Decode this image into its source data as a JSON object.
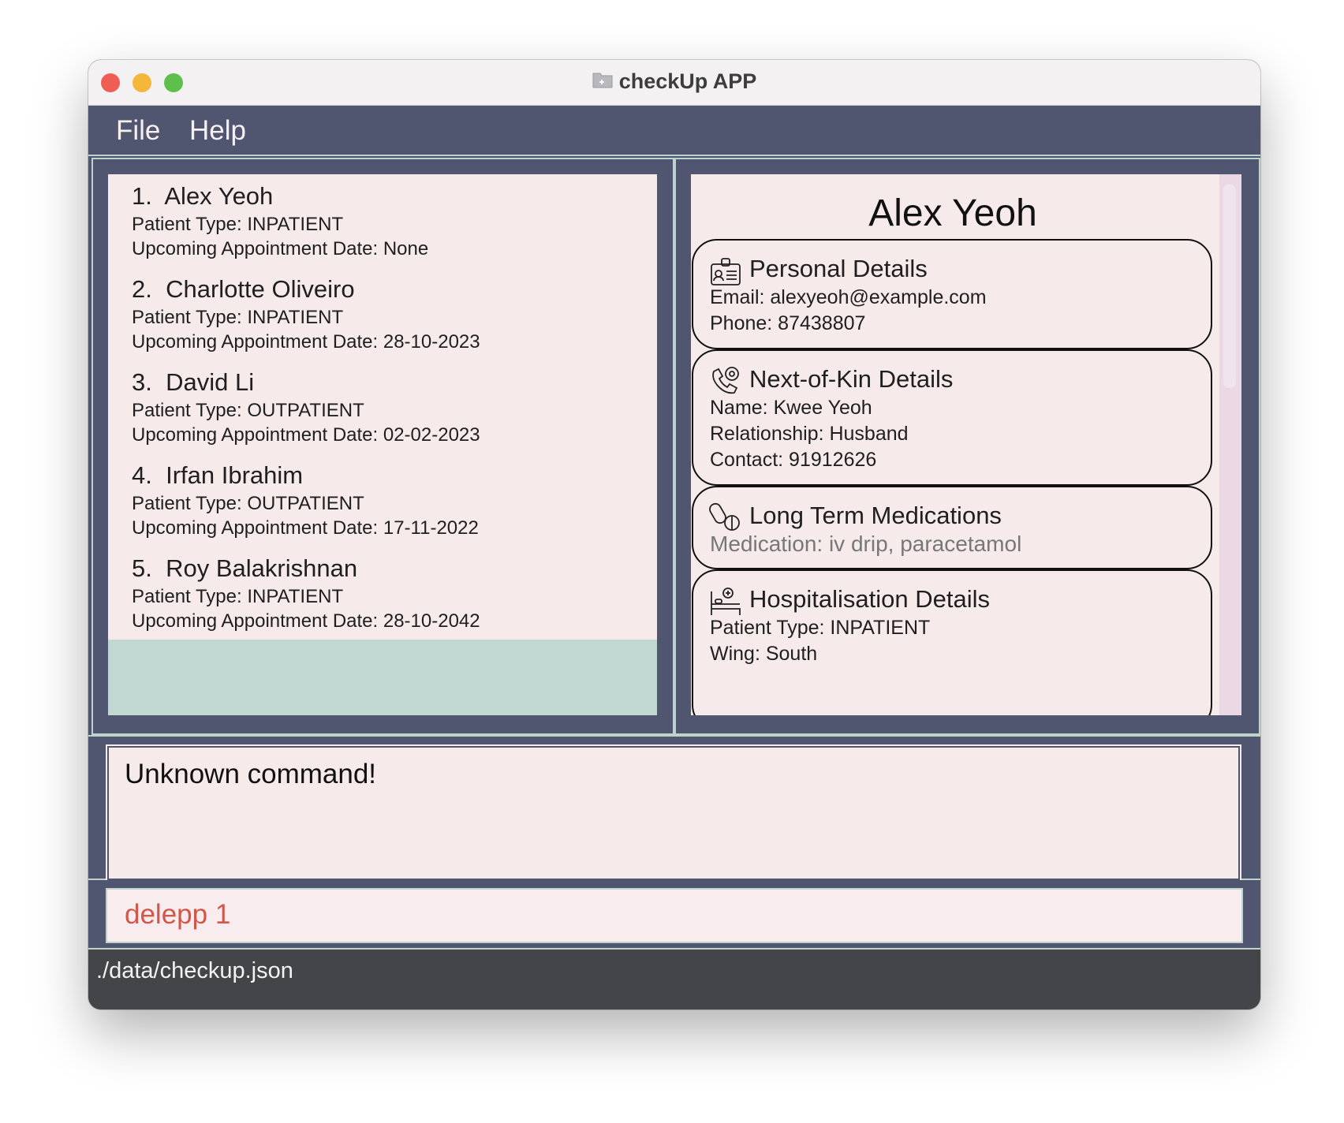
{
  "window": {
    "title": "checkUp APP",
    "title_icon": "folder-icon"
  },
  "menu": {
    "file": "File",
    "help": "Help"
  },
  "patients": [
    {
      "index": "1.",
      "name": "Alex Yeoh",
      "type": "Patient Type: INPATIENT",
      "appointment": "Upcoming Appointment Date: None"
    },
    {
      "index": "2.",
      "name": "Charlotte Oliveiro",
      "type": "Patient Type: INPATIENT",
      "appointment": "Upcoming Appointment Date: 28-10-2023"
    },
    {
      "index": "3.",
      "name": "David Li",
      "type": "Patient Type: OUTPATIENT",
      "appointment": "Upcoming Appointment Date: 02-02-2023"
    },
    {
      "index": "4.",
      "name": "Irfan Ibrahim",
      "type": "Patient Type: OUTPATIENT",
      "appointment": "Upcoming Appointment Date: 17-11-2022"
    },
    {
      "index": "5.",
      "name": "Roy Balakrishnan",
      "type": "Patient Type: INPATIENT",
      "appointment": "Upcoming Appointment Date: 28-10-2042"
    }
  ],
  "details": {
    "name": "Alex Yeoh",
    "personal": {
      "title": "Personal Details",
      "icon": "id-badge-icon",
      "email": "Email: alexyeoh@example.com",
      "phone": "Phone: 87438807"
    },
    "kin": {
      "title": "Next-of-Kin Details",
      "icon": "phone-contact-icon",
      "name": "Name: Kwee Yeoh",
      "relationship": "Relationship: Husband",
      "contact": "Contact: 91912626"
    },
    "medications": {
      "title": "Long Term Medications",
      "icon": "pills-icon",
      "medication": "Medication: iv drip, paracetamol"
    },
    "hospitalisation": {
      "title": "Hospitalisation Details",
      "icon": "hospital-bed-icon",
      "type": "Patient Type: INPATIENT",
      "wing": "Wing: South"
    }
  },
  "result": {
    "message": "Unknown command!"
  },
  "command": {
    "value": "delepp 1"
  },
  "status": {
    "path": "./data/checkup.json"
  },
  "colors": {
    "panel": "#515670",
    "card": "#f6eaeb",
    "accent_border": "#bfd3cd",
    "command_text": "#d0584a",
    "status_bar": "#444548"
  }
}
